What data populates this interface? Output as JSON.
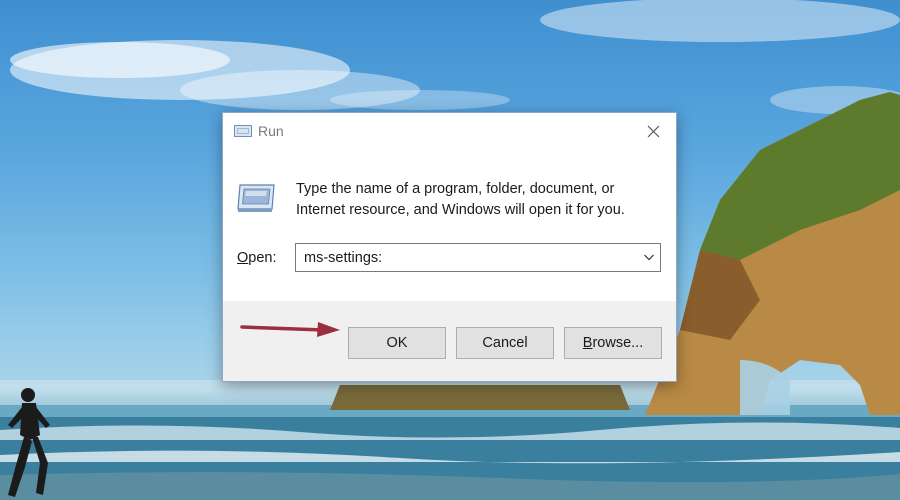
{
  "dialog": {
    "title": "Run",
    "close_icon": "close-icon",
    "description": "Type the name of a program, folder, document, or Internet resource, and Windows will open it for you.",
    "open_label_accesskey": "O",
    "open_label_rest": "pen:",
    "open_value": "ms-settings:",
    "buttons": {
      "ok": "OK",
      "cancel": "Cancel",
      "browse_accesskey": "B",
      "browse_rest": "rowse..."
    }
  },
  "icons": {
    "title": "run-icon",
    "large": "run-icon",
    "dropdown": "chevron-down-icon",
    "annotation": "arrow-right-icon"
  },
  "colors": {
    "arrow_annotation": "#9b2f3f",
    "dialog_border": "#8fa7c4",
    "footer_bg": "#f0f0f0",
    "button_bg": "#e1e1e1"
  }
}
